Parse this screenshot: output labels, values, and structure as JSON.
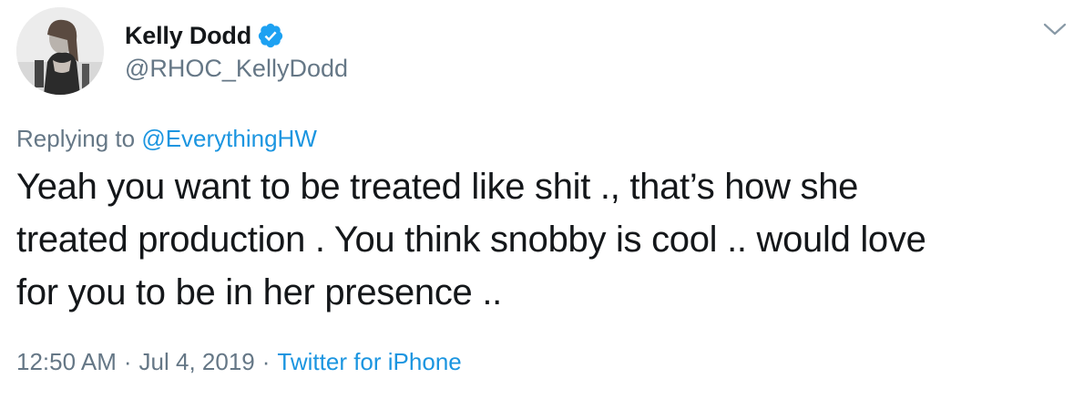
{
  "tweet": {
    "author": {
      "display_name": "Kelly Dodd",
      "handle": "@RHOC_KellyDodd",
      "verified": true,
      "verified_color": "#1da1f2"
    },
    "reply": {
      "prefix": "Replying to",
      "mention": "@EverythingHW"
    },
    "text": "Yeah you want to be treated like shit .,  that’s how she\ntreated production .  You think snobby is cool .. would love\nfor you to be in her presence ..",
    "meta": {
      "time": "12:50 AM",
      "separator": "·",
      "date": "Jul 4, 2019",
      "source": "Twitter for iPhone"
    },
    "icons": {
      "avatar": "avatar-photo",
      "verified": "verified-badge-icon",
      "menu": "chevron-down-icon"
    },
    "colors": {
      "text": "#14171a",
      "secondary": "#657786",
      "link": "#1b95e0"
    }
  }
}
